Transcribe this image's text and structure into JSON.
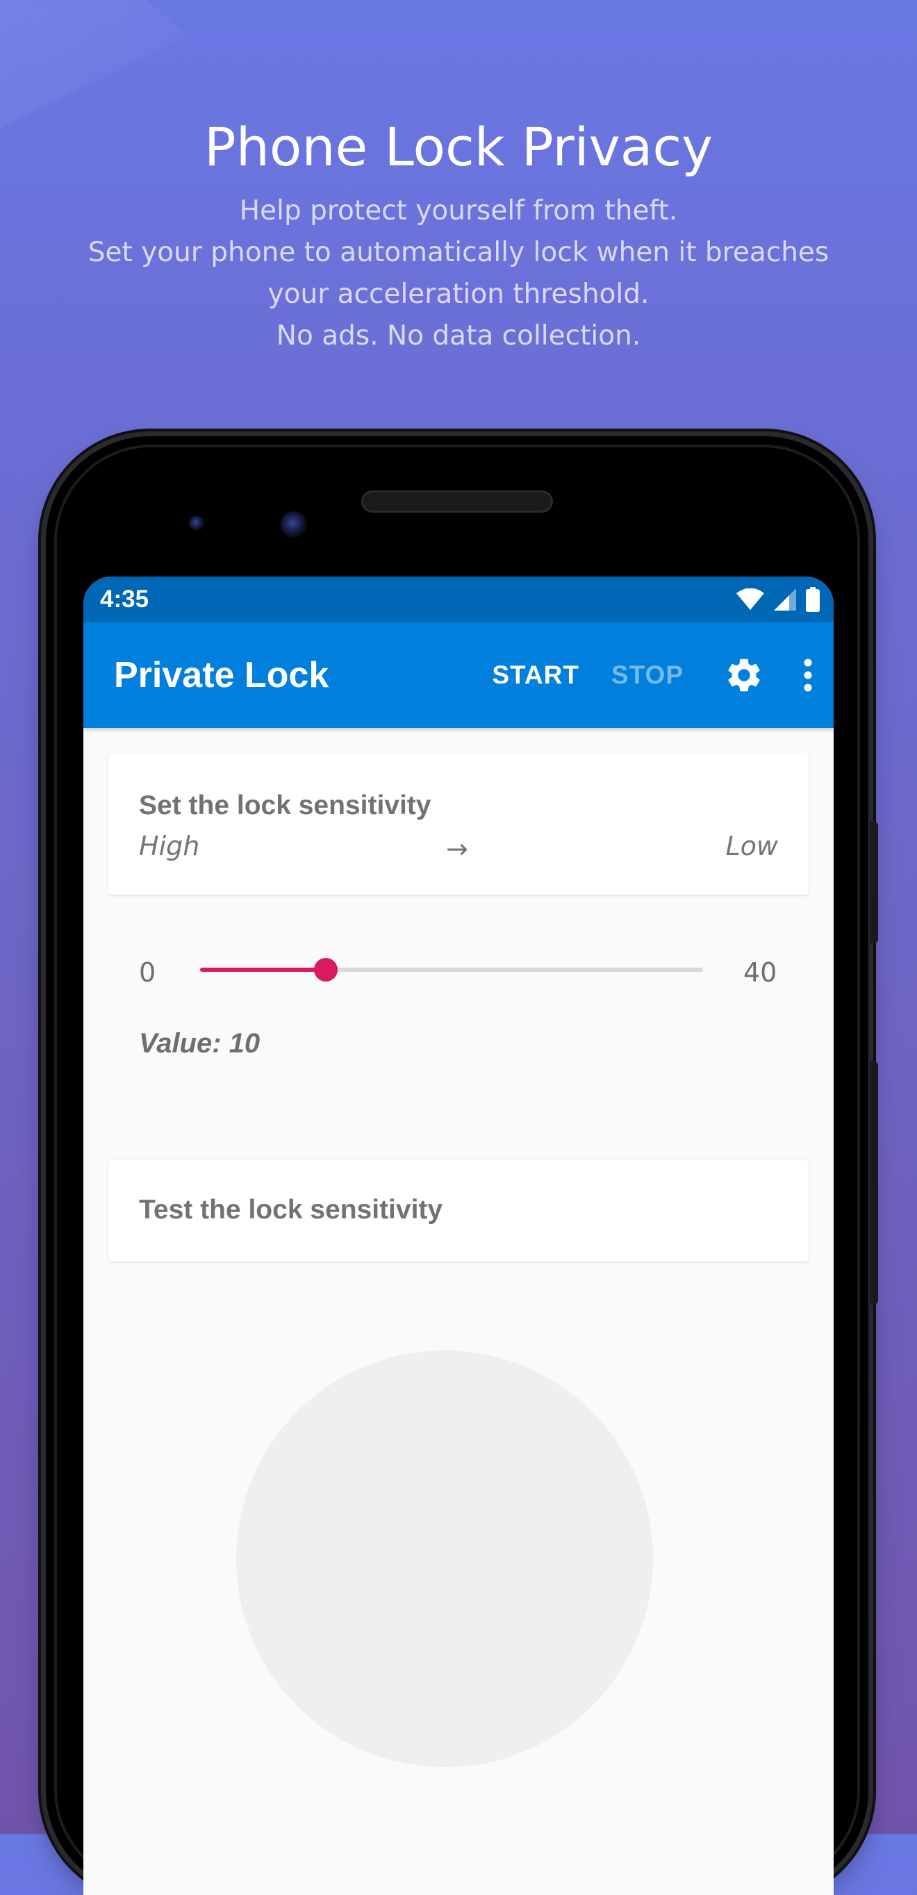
{
  "promo": {
    "title": "Phone Lock Privacy",
    "lines": [
      "Help protect yourself from theft.",
      "Set your phone to automatically lock when it breaches",
      "your acceleration threshold.",
      "No ads. No data collection."
    ]
  },
  "status_bar": {
    "time": "4:35",
    "icons": [
      "wifi-icon",
      "cell-signal-icon",
      "battery-icon"
    ]
  },
  "app_bar": {
    "title": "Private Lock",
    "start_label": "START",
    "stop_label": "STOP",
    "settings_icon": "gear-icon",
    "menu_icon": "overflow-menu-icon"
  },
  "sensitivity_card": {
    "title": "Set the lock sensitivity",
    "high_label": "High",
    "arrow": "→",
    "low_label": "Low"
  },
  "slider": {
    "min_label": "0",
    "max_label": "40",
    "min": 0,
    "max": 40,
    "value": 10,
    "value_text": "Value: 10"
  },
  "test_card": {
    "title": "Test the lock sensitivity"
  },
  "colors": {
    "status_bar": "#0067b6",
    "app_bar": "#0080dc",
    "slider_accent": "#d81b60",
    "slider_track": "#d6d9de",
    "test_area": "#efefef"
  }
}
